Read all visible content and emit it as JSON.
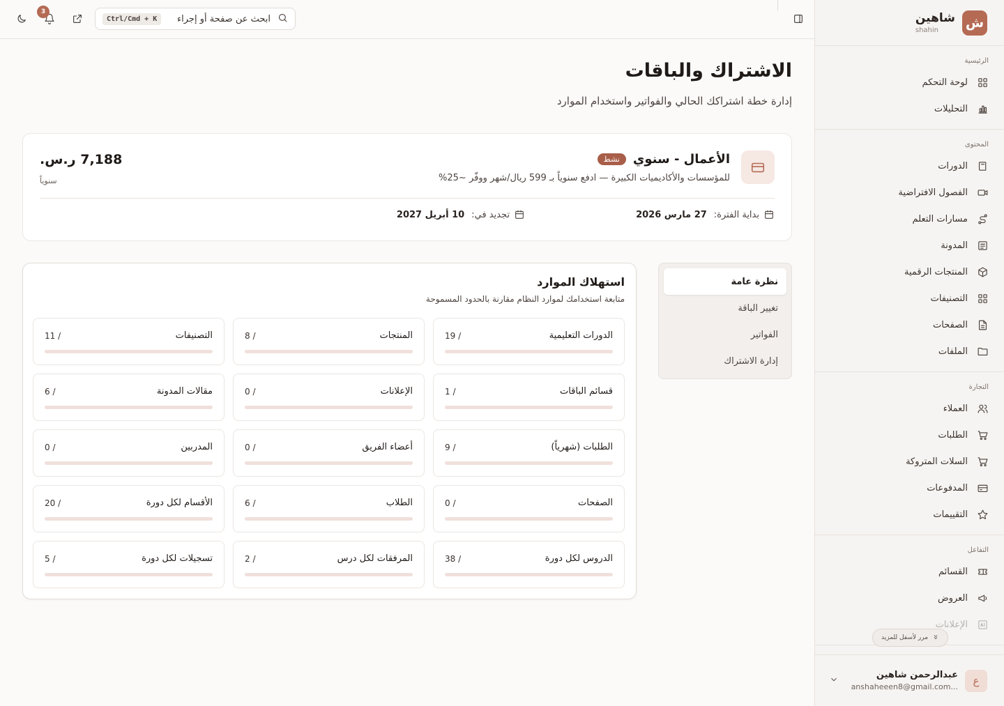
{
  "brand": {
    "logo_letter": "ش",
    "name": "شاهين",
    "sub": "shahin"
  },
  "sidebar": {
    "sections": [
      {
        "title": "الرئيسية",
        "items": [
          {
            "label": "لوحة التحكم",
            "icon": "dashboard-icon"
          },
          {
            "label": "التحليلات",
            "icon": "analytics-icon"
          }
        ]
      },
      {
        "title": "المحتوى",
        "items": [
          {
            "label": "الدورات",
            "icon": "book-icon"
          },
          {
            "label": "الفصول الافتراضية",
            "icon": "video-icon"
          },
          {
            "label": "مسارات التعلم",
            "icon": "route-icon"
          },
          {
            "label": "المدونة",
            "icon": "newspaper-icon"
          },
          {
            "label": "المنتجات الرقمية",
            "icon": "package-icon"
          },
          {
            "label": "التصنيفات",
            "icon": "grid-icon"
          },
          {
            "label": "الصفحات",
            "icon": "file-icon"
          },
          {
            "label": "الملفات",
            "icon": "folder-icon"
          }
        ]
      },
      {
        "title": "التجارة",
        "items": [
          {
            "label": "العملاء",
            "icon": "users-icon"
          },
          {
            "label": "الطلبات",
            "icon": "cart-icon"
          },
          {
            "label": "السلات المتروكة",
            "icon": "cart-icon"
          },
          {
            "label": "المدفوعات",
            "icon": "credit-card-icon"
          },
          {
            "label": "التقييمات",
            "icon": "star-icon"
          }
        ]
      },
      {
        "title": "التفاعل",
        "items": [
          {
            "label": "القسائم",
            "icon": "ticket-icon"
          },
          {
            "label": "العروض",
            "icon": "megaphone-icon"
          },
          {
            "label": "الإعلانات",
            "icon": "ad-icon"
          }
        ]
      }
    ],
    "scroll_more": "مرر لأسفل للمزيد"
  },
  "user": {
    "avatar_letter": "ع",
    "name": "عبدالرحمن شاهين",
    "email": "anshaheeen8@gmail.com..."
  },
  "topbar": {
    "search_placeholder": "ابحث عن صفحة أو إجراء",
    "shortcut": "Ctrl/Cmd + K",
    "notifications_count": "3"
  },
  "page": {
    "title": "الاشتراك والباقات",
    "subtitle": "إدارة خطة اشتراكك الحالي والفواتير واستخدام الموارد"
  },
  "plan": {
    "name": "الأعمال - سنوي",
    "status": "نشط",
    "description": "للمؤسسات والأكاديميات الكبيرة — ادفع سنوياً بـ 599 ريال/شهر ووفّر ~25%",
    "price": "7,188 ر.س.",
    "period": "سنوياً",
    "start_label": "بداية الفترة:",
    "start_date": "27 مارس 2026",
    "renew_label": "تجديد في:",
    "renew_date": "10 أبريل 2027"
  },
  "tabs": [
    "نظرة عامة",
    "تغيير الباقة",
    "الفواتير",
    "إدارة الاشتراك"
  ],
  "usage": {
    "title": "استهلاك الموارد",
    "subtitle": "متابعة استخدامك لموارد النظام مقارنة بالحدود المسموحة",
    "metrics": [
      {
        "label": "الدورات التعليمية",
        "value": "19 /",
        "fraction": 0
      },
      {
        "label": "المنتجات",
        "value": "8 /",
        "fraction": 0
      },
      {
        "label": "التصنيفات",
        "value": "11 /",
        "fraction": 0
      },
      {
        "label": "قسائم الباقات",
        "value": "1 /",
        "fraction": 0
      },
      {
        "label": "الإعلانات",
        "value": "0 /",
        "fraction": 0
      },
      {
        "label": "مقالات المدونة",
        "value": "6 /",
        "fraction": 0
      },
      {
        "label": "الطلبات (شهرياً)",
        "value": "9 /",
        "fraction": 0
      },
      {
        "label": "أعضاء الفريق",
        "value": "0 /",
        "fraction": 0
      },
      {
        "label": "المدربين",
        "value": "0 /",
        "fraction": 0
      },
      {
        "label": "الصفحات",
        "value": "0 /",
        "fraction": 0
      },
      {
        "label": "الطلاب",
        "value": "6 /",
        "fraction": 0
      },
      {
        "label": "الأقسام لكل دورة",
        "value": "20 /",
        "fraction": 0
      },
      {
        "label": "الدروس لكل دورة",
        "value": "38 /",
        "fraction": 0
      },
      {
        "label": "المرفقات لكل درس",
        "value": "2 /",
        "fraction": 0
      },
      {
        "label": "تسجيلات لكل دورة",
        "value": "5 /",
        "fraction": 0
      }
    ]
  },
  "colors": {
    "accent": "#b56a54",
    "badge": "#a85e48",
    "bar_track": "#f0e0db"
  }
}
